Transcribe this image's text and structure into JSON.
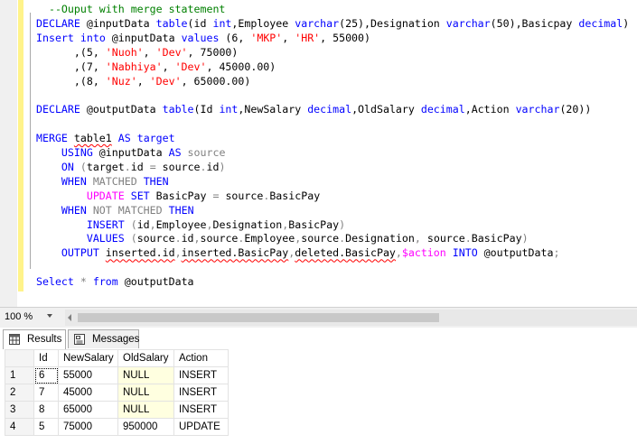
{
  "editor": {
    "lines": [
      [
        [
          "  --Ouput with merge statement",
          "cm"
        ]
      ],
      [
        [
          "DECLARE",
          "kw"
        ],
        [
          " @inputData ",
          ""
        ],
        [
          "table",
          "kw"
        ],
        [
          "(id ",
          ""
        ],
        [
          "int",
          "kw"
        ],
        [
          ",Employee ",
          ""
        ],
        [
          "varchar",
          "kw"
        ],
        [
          "(25),Designation ",
          ""
        ],
        [
          "varchar",
          "kw"
        ],
        [
          "(50),Basicpay ",
          ""
        ],
        [
          "decimal",
          "kw"
        ],
        [
          ")",
          ""
        ]
      ],
      [
        [
          "Insert",
          "kw"
        ],
        [
          " ",
          ""
        ],
        [
          "into",
          "kw"
        ],
        [
          " @inputData ",
          ""
        ],
        [
          "values",
          "kw"
        ],
        [
          " (6, ",
          ""
        ],
        [
          "'MKP'",
          "st"
        ],
        [
          ", ",
          ""
        ],
        [
          "'HR'",
          "st"
        ],
        [
          ", 55000)",
          ""
        ]
      ],
      [
        [
          "      ,(5, ",
          ""
        ],
        [
          "'Nuoh'",
          "st"
        ],
        [
          ", ",
          ""
        ],
        [
          "'Dev'",
          "st"
        ],
        [
          ", 75000)",
          ""
        ]
      ],
      [
        [
          "      ,(7, ",
          ""
        ],
        [
          "'Nabhiya'",
          "st"
        ],
        [
          ", ",
          ""
        ],
        [
          "'Dev'",
          "st"
        ],
        [
          ", 45000.00)",
          ""
        ]
      ],
      [
        [
          "      ,(8, ",
          ""
        ],
        [
          "'Nuz'",
          "st"
        ],
        [
          ", ",
          ""
        ],
        [
          "'Dev'",
          "st"
        ],
        [
          ", 65000.00)",
          ""
        ]
      ],
      [],
      [
        [
          "DECLARE",
          "kw"
        ],
        [
          " @outputData ",
          ""
        ],
        [
          "table",
          "kw"
        ],
        [
          "(Id ",
          ""
        ],
        [
          "int",
          "kw"
        ],
        [
          ",NewSalary ",
          ""
        ],
        [
          "decimal",
          "kw"
        ],
        [
          ",OldSalary ",
          ""
        ],
        [
          "decimal",
          "kw"
        ],
        [
          ",Action ",
          ""
        ],
        [
          "varchar",
          "kw"
        ],
        [
          "(20))",
          ""
        ]
      ],
      [],
      [
        [
          "MERGE",
          "kw"
        ],
        [
          " ",
          ""
        ],
        [
          "table1",
          "squig"
        ],
        [
          " ",
          ""
        ],
        [
          "AS",
          "kw"
        ],
        [
          " ",
          ""
        ],
        [
          "target",
          "kw"
        ]
      ],
      [
        [
          "    ",
          ""
        ],
        [
          "USING",
          "kw"
        ],
        [
          " @inputData ",
          ""
        ],
        [
          "AS",
          "kw"
        ],
        [
          " ",
          ""
        ],
        [
          "source",
          "gr"
        ]
      ],
      [
        [
          "    ",
          ""
        ],
        [
          "ON",
          "kw"
        ],
        [
          " ",
          ""
        ],
        [
          "(",
          "gr"
        ],
        [
          "target",
          ""
        ],
        [
          ".",
          "gr"
        ],
        [
          "id ",
          ""
        ],
        [
          "=",
          "gr"
        ],
        [
          " source",
          ""
        ],
        [
          ".",
          "gr"
        ],
        [
          "id",
          ""
        ],
        [
          ")",
          "gr"
        ]
      ],
      [
        [
          "    ",
          ""
        ],
        [
          "WHEN",
          "kw"
        ],
        [
          " ",
          ""
        ],
        [
          "MATCHED",
          "gr"
        ],
        [
          " ",
          ""
        ],
        [
          "THEN",
          "kw"
        ]
      ],
      [
        [
          "        ",
          ""
        ],
        [
          "UPDATE",
          "mg"
        ],
        [
          " ",
          ""
        ],
        [
          "SET",
          "kw"
        ],
        [
          " BasicPay ",
          ""
        ],
        [
          "=",
          "gr"
        ],
        [
          " source",
          ""
        ],
        [
          ".",
          "gr"
        ],
        [
          "BasicPay",
          ""
        ]
      ],
      [
        [
          "    ",
          ""
        ],
        [
          "WHEN",
          "kw"
        ],
        [
          " ",
          ""
        ],
        [
          "NOT",
          "gr"
        ],
        [
          " ",
          ""
        ],
        [
          "MATCHED",
          "gr"
        ],
        [
          " ",
          ""
        ],
        [
          "THEN",
          "kw"
        ]
      ],
      [
        [
          "        ",
          ""
        ],
        [
          "INSERT",
          "kw"
        ],
        [
          " ",
          ""
        ],
        [
          "(",
          "gr"
        ],
        [
          "id",
          ""
        ],
        [
          ",",
          "gr"
        ],
        [
          "Employee",
          ""
        ],
        [
          ",",
          "gr"
        ],
        [
          "Designation",
          ""
        ],
        [
          ",",
          "gr"
        ],
        [
          "BasicPay",
          ""
        ],
        [
          ")",
          "gr"
        ]
      ],
      [
        [
          "        ",
          ""
        ],
        [
          "VALUES",
          "kw"
        ],
        [
          " ",
          ""
        ],
        [
          "(",
          "gr"
        ],
        [
          "source",
          ""
        ],
        [
          ".",
          "gr"
        ],
        [
          "id",
          ""
        ],
        [
          ",",
          "gr"
        ],
        [
          "source",
          ""
        ],
        [
          ".",
          "gr"
        ],
        [
          "Employee",
          ""
        ],
        [
          ",",
          "gr"
        ],
        [
          "source",
          ""
        ],
        [
          ".",
          "gr"
        ],
        [
          "Designation",
          ""
        ],
        [
          ",",
          "gr"
        ],
        [
          " source",
          ""
        ],
        [
          ".",
          "gr"
        ],
        [
          "BasicPay",
          ""
        ],
        [
          ")",
          "gr"
        ]
      ],
      [
        [
          "    ",
          ""
        ],
        [
          "OUTPUT",
          "kw"
        ],
        [
          " ",
          ""
        ],
        [
          "inserted.id",
          "squig"
        ],
        [
          ",",
          "gr"
        ],
        [
          "inserted.BasicPay",
          "squig"
        ],
        [
          ",",
          "gr"
        ],
        [
          "deleted.BasicPay",
          "squig"
        ],
        [
          ",",
          "gr"
        ],
        [
          "$action",
          "mg"
        ],
        [
          " ",
          ""
        ],
        [
          "INTO",
          "kw"
        ],
        [
          " @outputData",
          ""
        ],
        [
          ";",
          "gr"
        ]
      ],
      [],
      [
        [
          "Select",
          "kw"
        ],
        [
          " ",
          ""
        ],
        [
          "*",
          "gr"
        ],
        [
          " ",
          ""
        ],
        [
          "from",
          "kw"
        ],
        [
          " @outputData",
          ""
        ]
      ]
    ]
  },
  "statusbar": {
    "zoom": "100 %"
  },
  "tabs": [
    {
      "id": "results",
      "label": "Results",
      "icon": "grid-icon",
      "active": true
    },
    {
      "id": "messages",
      "label": "Messages",
      "icon": "message-icon",
      "active": false
    }
  ],
  "grid": {
    "columns": [
      "Id",
      "NewSalary",
      "OldSalary",
      "Action"
    ],
    "rows": [
      {
        "num": "1",
        "cells": [
          "6",
          "55000",
          "NULL",
          "INSERT"
        ]
      },
      {
        "num": "2",
        "cells": [
          "7",
          "45000",
          "NULL",
          "INSERT"
        ]
      },
      {
        "num": "3",
        "cells": [
          "8",
          "65000",
          "NULL",
          "INSERT"
        ]
      },
      {
        "num": "4",
        "cells": [
          "5",
          "75000",
          "950000",
          "UPDATE"
        ]
      }
    ]
  },
  "colors": {
    "keyword": "#0000ff",
    "string": "#ff0000",
    "comment": "#008000",
    "operator": "#808080",
    "function": "#ff00ff",
    "null_bg": "#ffffe0"
  }
}
